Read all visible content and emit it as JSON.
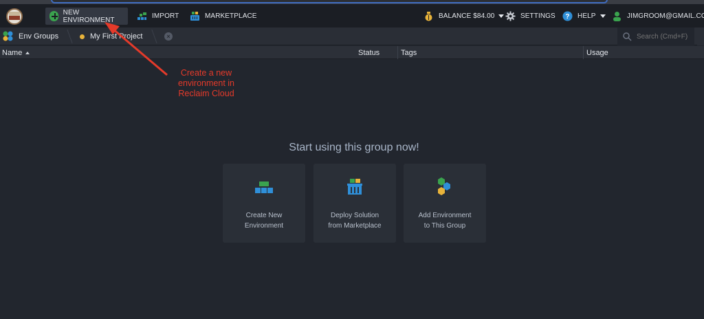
{
  "toolbar": {
    "new_environment": "NEW ENVIRONMENT",
    "import": "IMPORT",
    "marketplace": "MARKETPLACE",
    "balance": "BALANCE $84.00",
    "settings": "SETTINGS",
    "help": "HELP",
    "user": "JIMGROOM@GMAIL.COM"
  },
  "groups": {
    "env_groups": "Env Groups",
    "project": "My First Project",
    "search_placeholder": "Search (Cmd+F)"
  },
  "table": {
    "columns": [
      "Name",
      "Status",
      "Tags",
      "Usage"
    ]
  },
  "empty_state": {
    "title": "Start using this group now!",
    "cards": [
      {
        "line1": "Create New",
        "line2": "Environment"
      },
      {
        "line1": "Deploy Solution",
        "line2": "from Marketplace"
      },
      {
        "line1": "Add Environment",
        "line2": "to This Group"
      }
    ]
  },
  "annotation": {
    "line1": "Create a new",
    "line2": "environment in",
    "line3": "Reclaim Cloud"
  },
  "colors": {
    "background": "#22262e",
    "topbar": "#1b1e24",
    "accent_green": "#3aa34e",
    "annotation_red": "#e53a2a"
  },
  "icons": {
    "logo": "reclaim-cloud-logo",
    "new_environment": "plus-circle-icon",
    "import": "import-blocks-icon",
    "marketplace": "basket-icon",
    "balance": "money-bag-icon",
    "settings": "gear-icon",
    "help": "help-icon",
    "user": "user-icon",
    "search": "search-icon"
  }
}
